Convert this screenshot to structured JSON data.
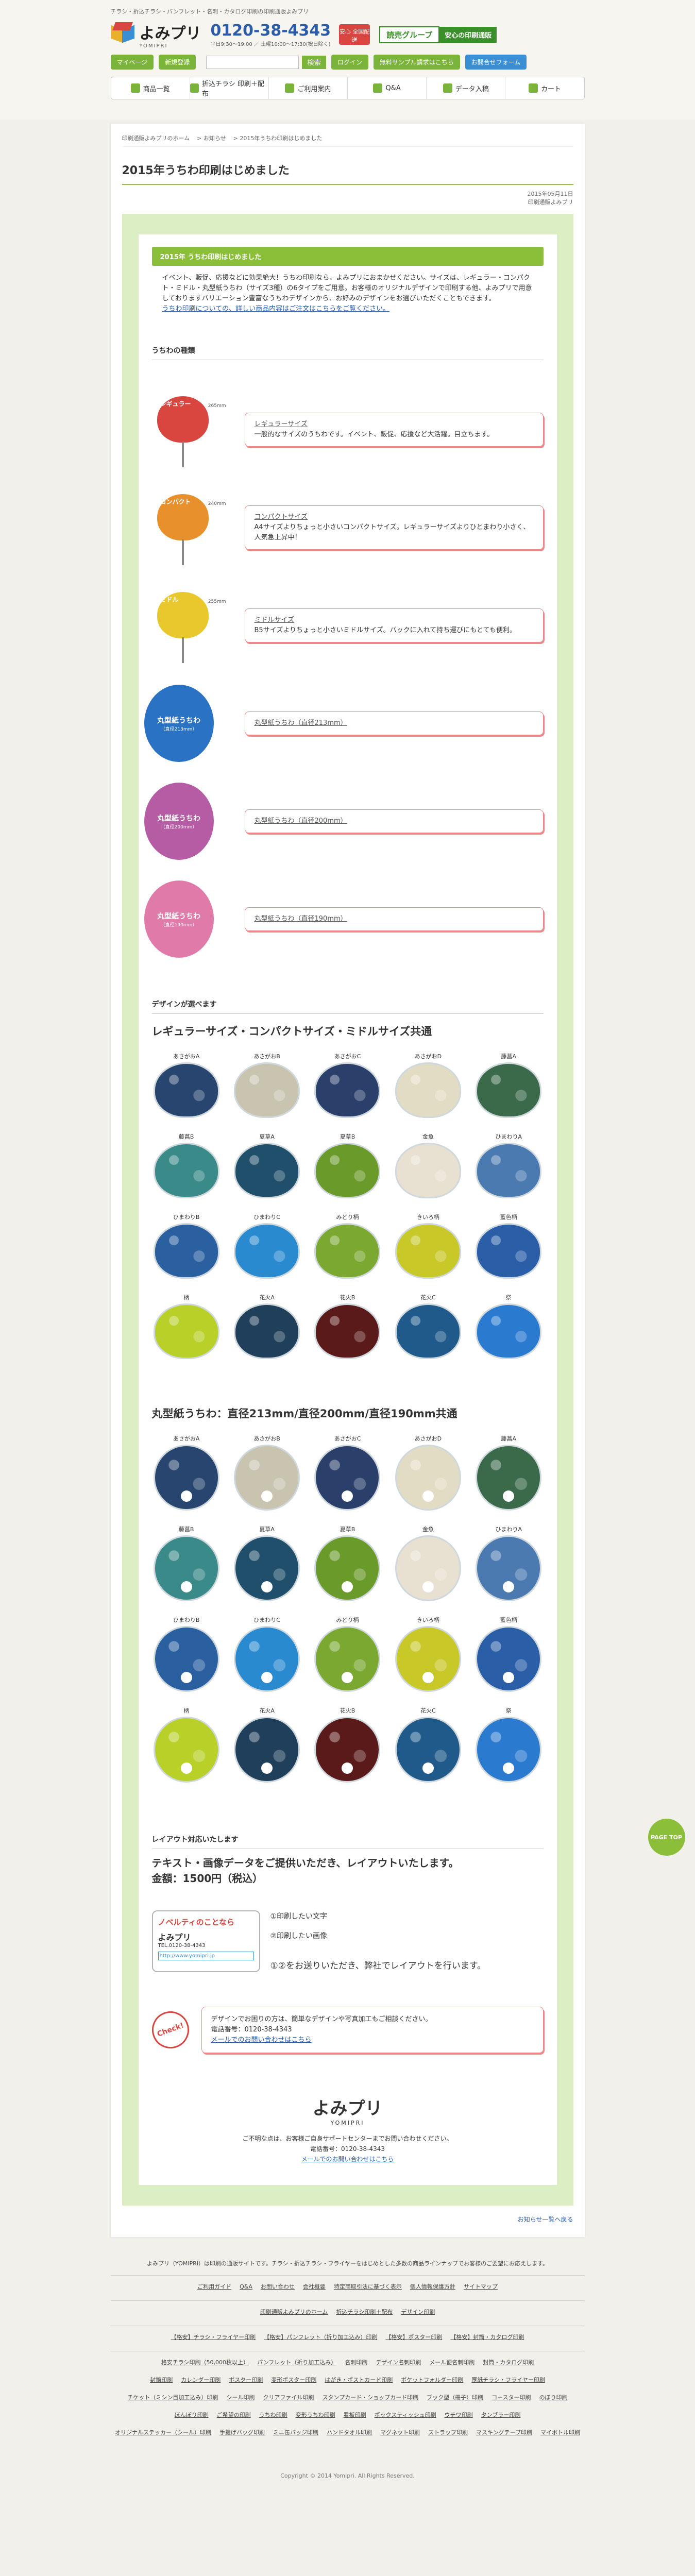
{
  "header": {
    "tagline": "チラシ・折込チラシ・パンフレット・名刺・カタログ印刷の印刷通販よみプリ",
    "logo_ja": "よみプリ",
    "logo_en": "YOMIPRI",
    "phone": "0120-38-4343",
    "hours": "平日9:30〜19:00 ／ 土曜10:00〜17:30(祝日除く)",
    "badge": "安心 全国配送",
    "group1": "読売グループ",
    "group2": "安心の印刷通販",
    "btn_mypage": "マイページ",
    "btn_register": "新規登録",
    "btn_login": "ログイン",
    "btn_sample": "無料サンプル請求はこちら",
    "btn_estimate": "お問合せフォーム",
    "search_placeholder": "",
    "search_button": "検索",
    "nav": [
      "商品一覧",
      "折込チラシ 印刷＋配布",
      "ご利用案内",
      "Q&A",
      "データ入稿",
      "カート"
    ]
  },
  "breadcrumb": [
    "印刷通販よみプリのホーム",
    "お知らせ",
    "2015年うちわ印刷はじめました"
  ],
  "page": {
    "title": "2015年うちわ印刷はじめました",
    "date": "2015年05月11日",
    "author": "印刷通販よみプリ",
    "bar": "2015年 うちわ印刷はじめました",
    "intro": "イベント、販促、応援などに効果絶大！うちわ印刷なら、よみプリにおまかせください。サイズは、レギュラー・コンパクト・ミドル・丸型紙うちわ（サイズ3種）の6タイプをご用意。お客様のオリジナルデザインで印刷する他、よみプリで用意しておりますバリエーション豊富なうちわデザインから、お好みのデザインをお選びいただくこともできます。",
    "intro_link": "うちわ印刷についての、詳しい商品内容はご注文はこちらをご覧ください。"
  },
  "types": {
    "heading": "うちわの種類",
    "items": [
      {
        "tag": "レギュラー",
        "dim": "265mm",
        "color": "#d9453f",
        "name": "レギュラーサイズ",
        "desc": "一般的なサイズのうちわです。イベント、販促、応援など大活躍。目立ちます。"
      },
      {
        "tag": "コンパクト",
        "dim": "240mm",
        "color": "#e8912c",
        "name": "コンパクトサイズ",
        "desc": "A4サイズよりちょっと小さいコンパクトサイズ。レギュラーサイズよりひとまわり小さく、人気急上昇中！"
      },
      {
        "tag": "ミドル",
        "dim": "255mm",
        "color": "#e8c82c",
        "name": "ミドルサイズ",
        "desc": "B5サイズよりちょっと小さいミドルサイズ。バックに入れて持ち運びにもとても便利。"
      },
      {
        "tag": "丸型紙うちわ",
        "sub": "（直径213mm）",
        "color": "#2a72c4",
        "name": "丸型紙うちわ（直径213mm）",
        "desc": ""
      },
      {
        "tag": "丸型紙うちわ",
        "sub": "（直径200mm）",
        "color": "#b55ca4",
        "name": "丸型紙うちわ（直径200mm）",
        "desc": ""
      },
      {
        "tag": "丸型紙うちわ",
        "sub": "（直径190mm）",
        "color": "#e07aa8",
        "name": "丸型紙うちわ（直径190mm）",
        "desc": ""
      }
    ]
  },
  "designs": {
    "heading": "デザインが選べます",
    "title1": "レギュラーサイズ・コンパクトサイズ・ミドルサイズ共通",
    "title2": "丸型紙うちわ：直径213mm/直径200mm/直径190mm共通",
    "items": [
      {
        "label": "あさがおA",
        "color": "#27456e"
      },
      {
        "label": "あさがおB",
        "color": "#c9c4b0"
      },
      {
        "label": "あさがおC",
        "color": "#2a3f6a"
      },
      {
        "label": "あさがおD",
        "color": "#e3dcc4"
      },
      {
        "label": "藤菖A",
        "color": "#3a6a4a"
      },
      {
        "label": "藤菖B",
        "color": "#3a8a8a"
      },
      {
        "label": "夏草A",
        "color": "#1f4f6a"
      },
      {
        "label": "夏草B",
        "color": "#6a9a2a"
      },
      {
        "label": "金魚",
        "color": "#e8e0d0"
      },
      {
        "label": "ひまわりA",
        "color": "#4a7ab0"
      },
      {
        "label": "ひまわりB",
        "color": "#2a5fa0"
      },
      {
        "label": "ひまわりC",
        "color": "#2a8ad0"
      },
      {
        "label": "みどり柄",
        "color": "#7aa830"
      },
      {
        "label": "きいろ柄",
        "color": "#c8c828"
      },
      {
        "label": "藍色柄",
        "color": "#2a5fa8"
      },
      {
        "label": "柄",
        "color": "#b8d028"
      },
      {
        "label": "花火A",
        "color": "#1f3f5a"
      },
      {
        "label": "花火B",
        "color": "#5a1a1a"
      },
      {
        "label": "花火C",
        "color": "#1f5a8a"
      },
      {
        "label": "祭",
        "color": "#2a7ad0"
      }
    ]
  },
  "layout": {
    "heading": "レイアウト対応いたします",
    "title": "テキスト・画像データをご提供いただき、レイアウトいたします。",
    "price": "金額：1500円（税込）",
    "sample_nov": "ノベルティのことなら",
    "sample_logo": "よみプリ",
    "sample_tel": "TEL.0120-38-4343",
    "sample_url": "http://www.yomipri.jp",
    "step1": "①印刷したい文字",
    "step2": "②印刷したい画像",
    "summary": "①②をお送りいただき、弊社でレイアウトを行います。"
  },
  "check": {
    "stamp": "Check!",
    "text": "デザインでお困りの方は、簡単なデザインや写真加工もご相談ください。",
    "phone": "電話番号：0120-38-4343",
    "mail": "メールでのお問い合わせはこちら"
  },
  "footer_block": {
    "logo": "よみプリ",
    "logo_en": "YOMIPRI",
    "text1": "ご不明な点は、お客様ご自身サポートセンターまでお問い合わせください。",
    "phone": "電話番号：0120-38-4343",
    "mail": "メールでのお問い合わせはこちら",
    "back": "お知らせ一覧へ戻る",
    "pagetop": "PAGE TOP"
  },
  "footer": {
    "desc": "よみプリ（YOMIPRI）は印刷の通販サイトです。チラシ・折込チラシ・フライヤーをはじめとした多数の商品ラインナップでお客様のご要望にお応えします。",
    "links1": [
      "ご利用ガイド",
      "Q&A",
      "お問い合わせ",
      "会社概要",
      "特定商取引法に基づく表示",
      "個人情報保護方針",
      "サイトマップ"
    ],
    "links2": [
      "印刷通販よみプリのホーム",
      "折込チラシ印刷＋配布",
      "デザイン印刷"
    ],
    "links3": [
      "【格安】チラシ・フライヤー印刷",
      "【格安】パンフレット（折り加工込み）印刷",
      "【格安】ポスター印刷",
      "【格安】封筒・カタログ印刷"
    ],
    "links4": [
      "格安チラシ印刷（50,000枚以上）",
      "パンフレット（折り加工込み）",
      "名刺印刷",
      "デザイン名刺印刷",
      "メール便名刺印刷",
      "封筒・カタログ印刷"
    ],
    "links5": [
      "封筒印刷",
      "カレンダー印刷",
      "ポスター印刷",
      "変形ポスター印刷",
      "はがき・ポストカード印刷",
      "ポケットフォルダー印刷",
      "厚紙チラシ・フライヤー印刷"
    ],
    "links6": [
      "チケット（ミシン目加工込み）印刷",
      "シール印刷",
      "クリアファイル印刷",
      "スタンプカード・ショップカード印刷",
      "ブック型（冊子）印刷",
      "コースター印刷",
      "のぼり印刷"
    ],
    "links7": [
      "ぼんぼり印刷",
      "ご希望の印刷",
      "うちわ印刷",
      "変形うちわ印刷",
      "看板印刷",
      "ボックスティッシュ印刷",
      "ウチワ印刷",
      "タンブラー印刷"
    ],
    "links8": [
      "オリジナルステッカー（シール）印刷",
      "手提げバッグ印刷",
      "ミニ缶バッジ印刷",
      "ハンドタオル印刷",
      "マグネット印刷",
      "ストラップ印刷",
      "マスキングテープ印刷",
      "マイボトル印刷"
    ],
    "copyright": "Copyright © 2014 Yomipri. All Rights Reserved."
  }
}
